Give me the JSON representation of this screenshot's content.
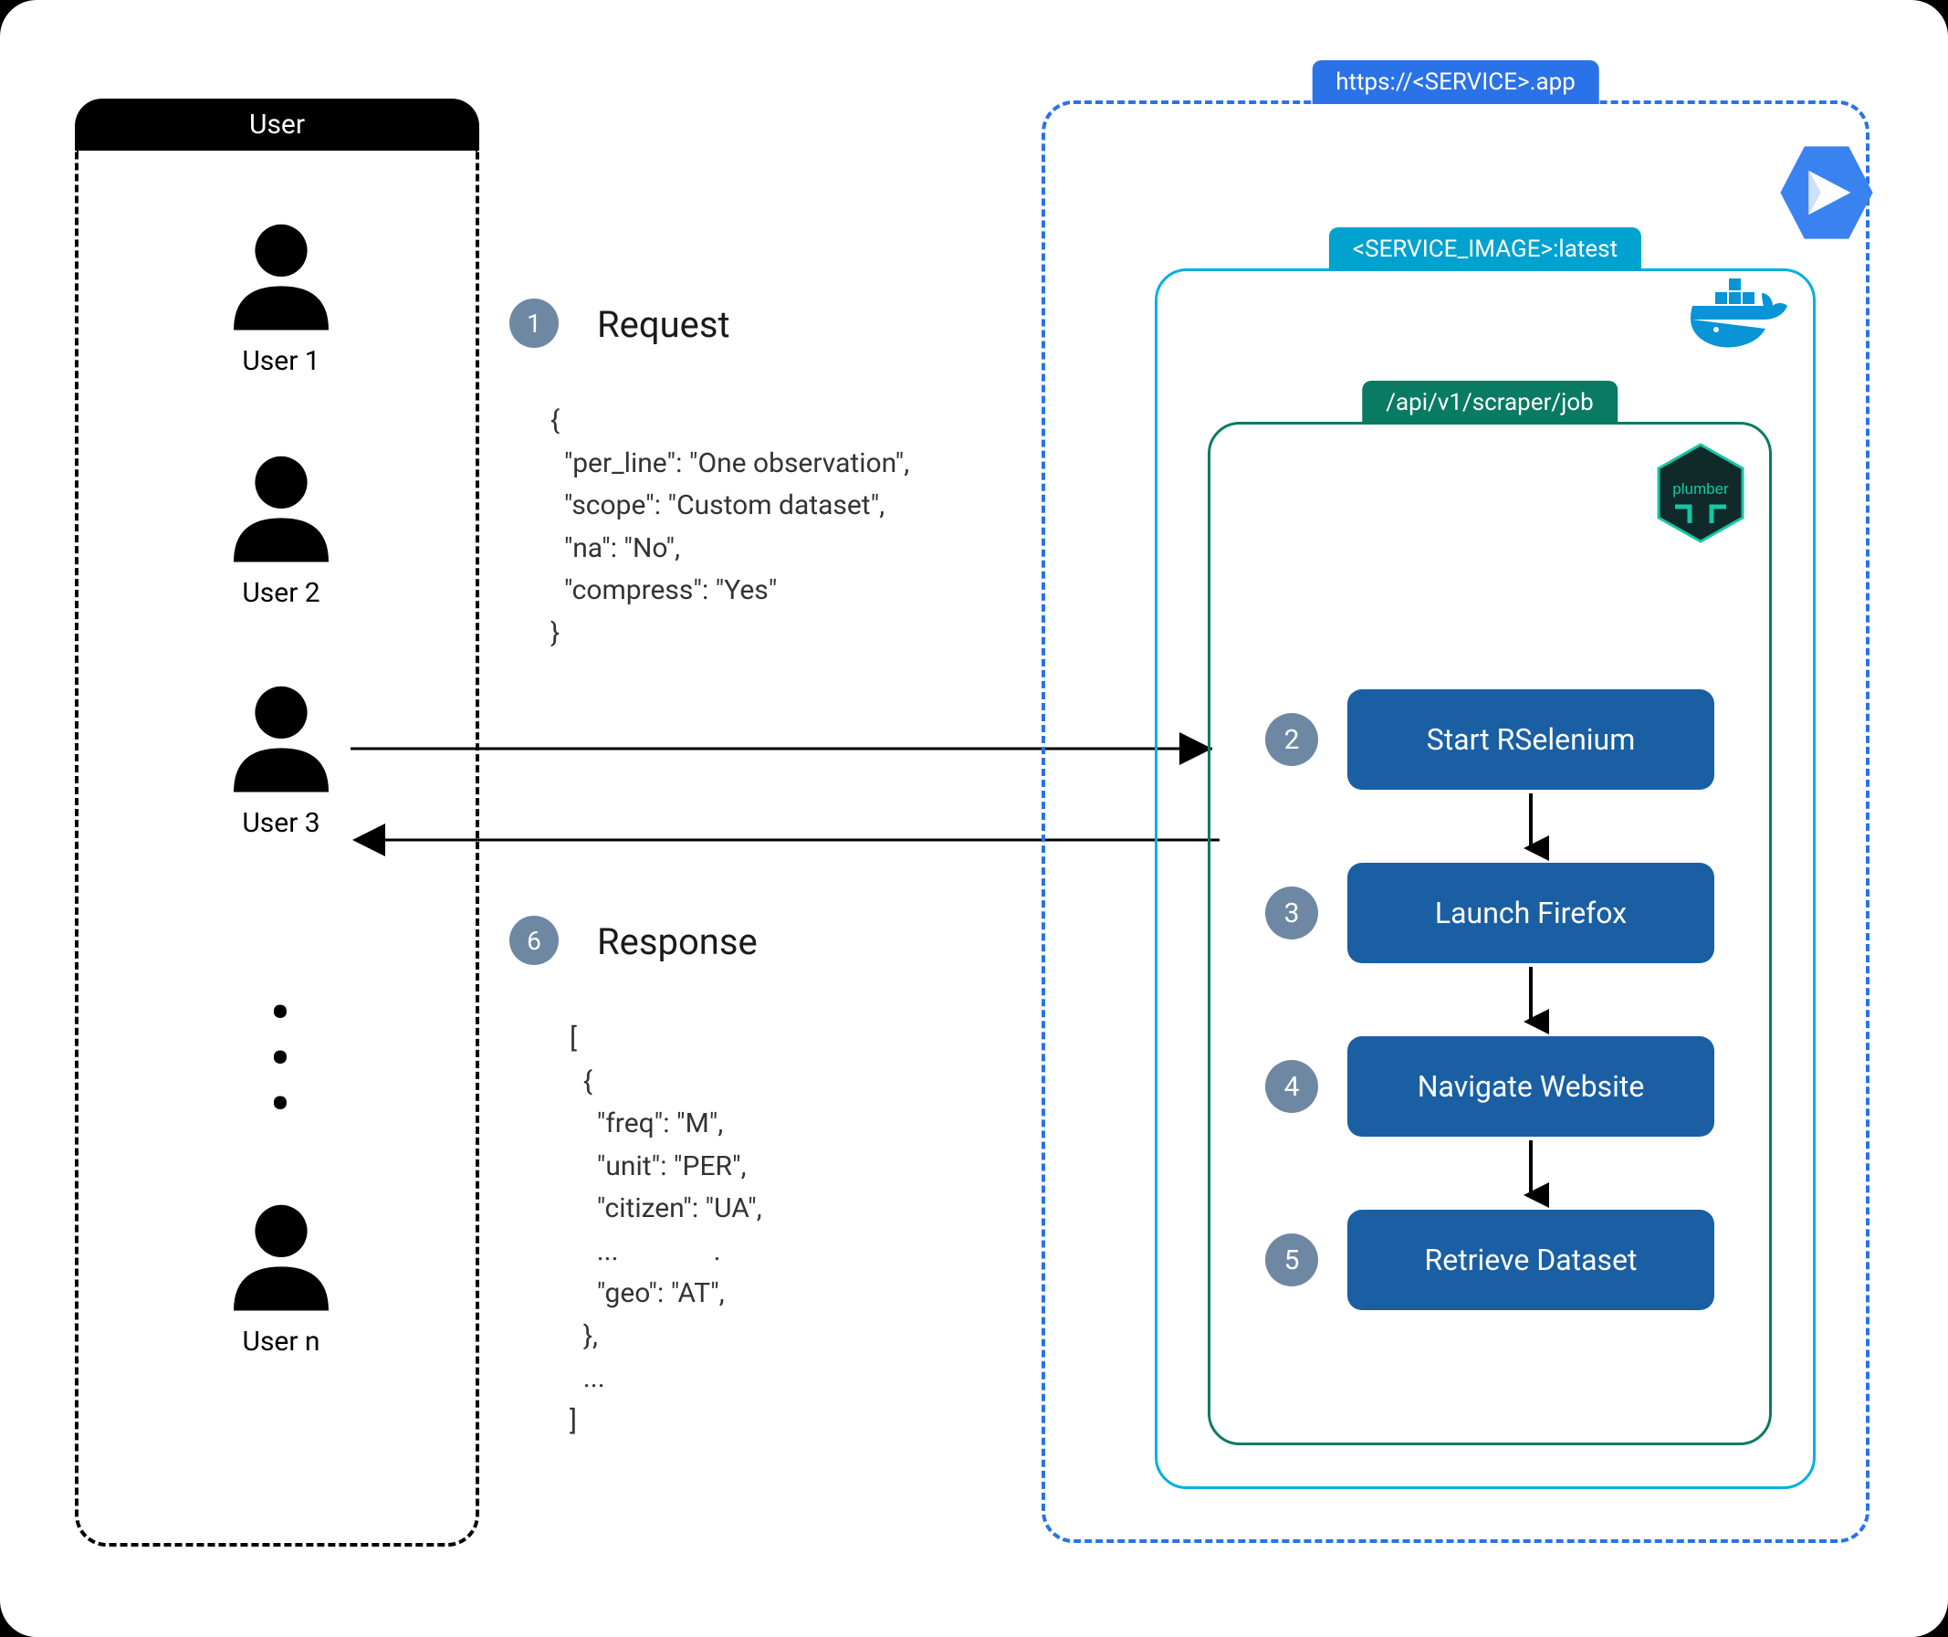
{
  "left": {
    "header": "User",
    "users": [
      "User 1",
      "User 2",
      "User 3",
      "User n"
    ]
  },
  "middle": {
    "request": {
      "badge": "1",
      "heading": "Request",
      "code": "{\n  \"per_line\": \"One observation\",\n  \"scope\": \"Custom dataset\",\n  \"na\": \"No\",\n  \"compress\": \"Yes\"\n}"
    },
    "response": {
      "badge": "6",
      "heading": "Response",
      "code": "[\n  {\n    \"freq\": \"M\",\n    \"unit\": \"PER\",\n    \"citizen\": \"UA\",\n    ...              .\n    \"geo\": \"AT\",\n  },\n  ...\n]"
    }
  },
  "right": {
    "outer_label": "https://<SERVICE>.app",
    "mid_label": "<SERVICE_IMAGE>:latest",
    "inner_label": "/api/v1/scraper/job",
    "steps": [
      {
        "n": "2",
        "label": "Start RSelenium"
      },
      {
        "n": "3",
        "label": "Launch Firefox"
      },
      {
        "n": "4",
        "label": "Navigate Website"
      },
      {
        "n": "5",
        "label": "Retrieve Dataset"
      }
    ],
    "icons": {
      "cloud_run": "cloud-run-icon",
      "docker": "docker-icon",
      "plumber": "plumber-icon"
    }
  },
  "colors": {
    "badge": "#6e88a4",
    "step_box": "#1a5fa3",
    "outer_border": "#2a72e8",
    "mid_border": "#00b0e0",
    "inner_border": "#0a7b63"
  }
}
